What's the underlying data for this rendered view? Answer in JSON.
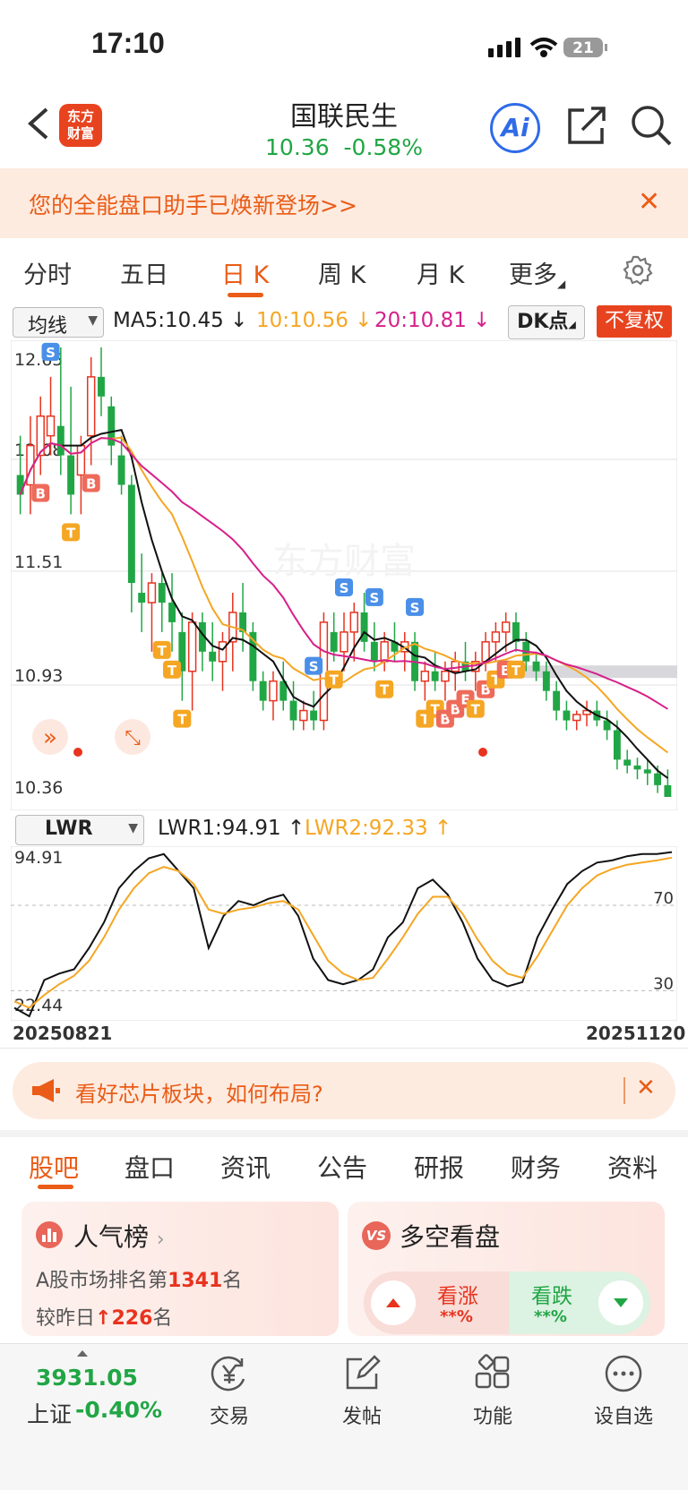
{
  "status_bar": {
    "time": "17:10",
    "battery": "21"
  },
  "header": {
    "logo_text_1": "东方",
    "logo_text_2": "财富",
    "stock_name": "国联民生",
    "price": "10.36",
    "change_pct": "-0.58%",
    "ai_label": "Ai"
  },
  "banner": {
    "text": "您的全能盘口助手已焕新登场>>"
  },
  "ktabs": [
    {
      "label": "分时"
    },
    {
      "label": "五日"
    },
    {
      "label": "日 K"
    },
    {
      "label": "周 K"
    },
    {
      "label": "月 K"
    },
    {
      "label": "更多"
    }
  ],
  "indicators": {
    "ma_select": "均线",
    "ma5": "MA5:10.45",
    "ma10": "10:10.56",
    "ma20": "20:10.81",
    "dk": "DK点",
    "fq": "不复权"
  },
  "chart_data": [
    {
      "type": "candlestick",
      "title": "",
      "y_ticks": [
        "12.65",
        "12.08",
        "11.51",
        "10.93",
        "10.36"
      ],
      "ylim": [
        10.36,
        12.65
      ],
      "series": [
        {
          "name": "MA5",
          "color": "#111111"
        },
        {
          "name": "MA10",
          "color": "#f5a623"
        },
        {
          "name": "MA20",
          "color": "#d6208b"
        }
      ],
      "candles": [
        [
          12.0,
          12.2,
          11.8,
          11.9
        ],
        [
          11.95,
          12.3,
          11.8,
          12.15
        ],
        [
          12.1,
          12.4,
          12.0,
          12.3
        ],
        [
          12.2,
          12.5,
          12.1,
          12.3
        ],
        [
          12.25,
          12.65,
          12.0,
          12.1
        ],
        [
          12.1,
          12.45,
          11.8,
          11.9
        ],
        [
          12.0,
          12.2,
          11.8,
          12.15
        ],
        [
          12.2,
          12.6,
          12.05,
          12.5
        ],
        [
          12.5,
          12.65,
          12.3,
          12.4
        ],
        [
          12.35,
          12.4,
          12.05,
          12.15
        ],
        [
          12.1,
          12.2,
          11.9,
          11.95
        ],
        [
          11.95,
          12.0,
          11.3,
          11.45
        ],
        [
          11.4,
          11.6,
          11.2,
          11.35
        ],
        [
          11.35,
          11.5,
          11.1,
          11.45
        ],
        [
          11.45,
          11.5,
          11.2,
          11.35
        ],
        [
          11.35,
          11.5,
          11.1,
          11.25
        ],
        [
          11.2,
          11.3,
          10.85,
          11.0
        ],
        [
          11.0,
          11.3,
          10.8,
          11.25
        ],
        [
          11.25,
          11.3,
          11.0,
          11.1
        ],
        [
          11.1,
          11.25,
          10.95,
          11.05
        ],
        [
          11.05,
          11.2,
          10.9,
          11.15
        ],
        [
          11.15,
          11.4,
          11.0,
          11.3
        ],
        [
          11.3,
          11.45,
          11.1,
          11.2
        ],
        [
          11.2,
          11.25,
          10.9,
          10.95
        ],
        [
          10.95,
          11.0,
          10.8,
          10.85
        ],
        [
          10.85,
          11.0,
          10.75,
          10.95
        ],
        [
          10.95,
          11.05,
          10.8,
          10.85
        ],
        [
          10.85,
          10.95,
          10.7,
          10.75
        ],
        [
          10.75,
          10.85,
          10.7,
          10.8
        ],
        [
          10.8,
          10.9,
          10.7,
          10.75
        ],
        [
          10.75,
          11.3,
          10.7,
          11.25
        ],
        [
          11.2,
          11.3,
          11.05,
          11.1
        ],
        [
          11.1,
          11.3,
          11.0,
          11.2
        ],
        [
          11.2,
          11.35,
          11.05,
          11.3
        ],
        [
          11.3,
          11.4,
          11.1,
          11.15
        ],
        [
          11.15,
          11.25,
          11.0,
          11.05
        ],
        [
          11.05,
          11.2,
          11.0,
          11.15
        ],
        [
          11.15,
          11.25,
          11.05,
          11.1
        ],
        [
          11.1,
          11.2,
          11.0,
          11.15
        ],
        [
          11.15,
          11.2,
          10.9,
          10.95
        ],
        [
          10.95,
          11.05,
          10.85,
          11.0
        ],
        [
          11.0,
          11.1,
          10.9,
          10.95
        ],
        [
          10.95,
          11.05,
          10.85,
          11.0
        ],
        [
          11.0,
          11.1,
          10.9,
          11.05
        ],
        [
          11.05,
          11.15,
          10.95,
          11.0
        ],
        [
          11.0,
          11.1,
          10.9,
          11.05
        ],
        [
          11.05,
          11.2,
          11.0,
          11.15
        ],
        [
          11.15,
          11.25,
          11.05,
          11.2
        ],
        [
          11.2,
          11.3,
          11.1,
          11.25
        ],
        [
          11.25,
          11.3,
          11.1,
          11.15
        ],
        [
          11.15,
          11.2,
          11.0,
          11.05
        ],
        [
          11.05,
          11.1,
          10.95,
          11.0
        ],
        [
          11.0,
          11.05,
          10.85,
          10.9
        ],
        [
          10.9,
          10.95,
          10.75,
          10.8
        ],
        [
          10.8,
          10.85,
          10.7,
          10.75
        ],
        [
          10.75,
          10.8,
          10.7,
          10.78
        ],
        [
          10.78,
          10.85,
          10.72,
          10.8
        ],
        [
          10.8,
          10.85,
          10.72,
          10.75
        ],
        [
          10.75,
          10.8,
          10.65,
          10.7
        ],
        [
          10.7,
          10.75,
          10.5,
          10.55
        ],
        [
          10.55,
          10.6,
          10.48,
          10.52
        ],
        [
          10.52,
          10.56,
          10.45,
          10.5
        ],
        [
          10.5,
          10.55,
          10.42,
          10.48
        ],
        [
          10.48,
          10.52,
          10.38,
          10.42
        ],
        [
          10.42,
          10.5,
          10.36,
          10.36
        ]
      ],
      "markers": [
        "S",
        "B",
        "B",
        "T",
        "T",
        "T",
        "T",
        "S",
        "T",
        "S",
        "S",
        "T",
        "S",
        "T",
        "T",
        "B",
        "B",
        "E",
        "T",
        "B",
        "T",
        "B",
        "T"
      ]
    },
    {
      "type": "line",
      "title": "",
      "series": [
        {
          "name": "LWR1",
          "color": "#111111",
          "values": [
            22,
            18,
            35,
            38,
            40,
            50,
            62,
            78,
            86,
            92,
            94,
            86,
            78,
            50,
            65,
            72,
            70,
            73,
            75,
            65,
            45,
            35,
            33,
            35,
            40,
            55,
            62,
            78,
            82,
            75,
            62,
            45,
            35,
            32,
            34,
            55,
            68,
            80,
            86,
            90,
            91,
            93,
            94,
            94,
            94.91
          ]
        },
        {
          "name": "LWR2",
          "color": "#f5a623",
          "values": [
            25,
            22,
            28,
            33,
            37,
            44,
            55,
            68,
            78,
            85,
            88,
            86,
            80,
            68,
            66,
            68,
            69,
            71,
            72,
            68,
            56,
            44,
            38,
            35,
            36,
            45,
            55,
            66,
            74,
            74,
            66,
            54,
            44,
            38,
            36,
            46,
            58,
            70,
            78,
            84,
            87,
            89,
            90,
            91,
            92.33
          ]
        }
      ],
      "ref_lines": [
        70,
        30
      ],
      "y_ticks": [
        "94.91",
        "70",
        "30",
        "22.44"
      ],
      "x_labels": [
        "20250821",
        "20251120"
      ]
    }
  ],
  "lwr": {
    "select": "LWR",
    "lwr1": "LWR1:94.91",
    "lwr2": "LWR2:92.33"
  },
  "promo": {
    "text": "看好芯片板块，如何布局?"
  },
  "bottom_tabs": [
    {
      "label": "股吧"
    },
    {
      "label": "盘口"
    },
    {
      "label": "资讯"
    },
    {
      "label": "公告"
    },
    {
      "label": "研报"
    },
    {
      "label": "财务"
    },
    {
      "label": "资料"
    }
  ],
  "popularity": {
    "title": "人气榜",
    "line1_pre": "A股市场排名第",
    "rank": "1341",
    "line1_post": "名",
    "line2_pre": "较昨日",
    "delta": "226",
    "line2_post": "名"
  },
  "vote": {
    "title": "多空看盘",
    "vs": "VS",
    "up_label": "看涨",
    "up_pct": "**%",
    "down_label": "看跌",
    "down_pct": "**%"
  },
  "bottom_nav": {
    "index_value": "3931.05",
    "index_name": "上证",
    "index_change": "-0.40%",
    "items": [
      {
        "label": "交易"
      },
      {
        "label": "发帖"
      },
      {
        "label": "功能"
      },
      {
        "label": "设自选"
      }
    ]
  },
  "colors": {
    "accent": "#ea5c17",
    "up": "#e8331f",
    "down": "#21a645"
  }
}
